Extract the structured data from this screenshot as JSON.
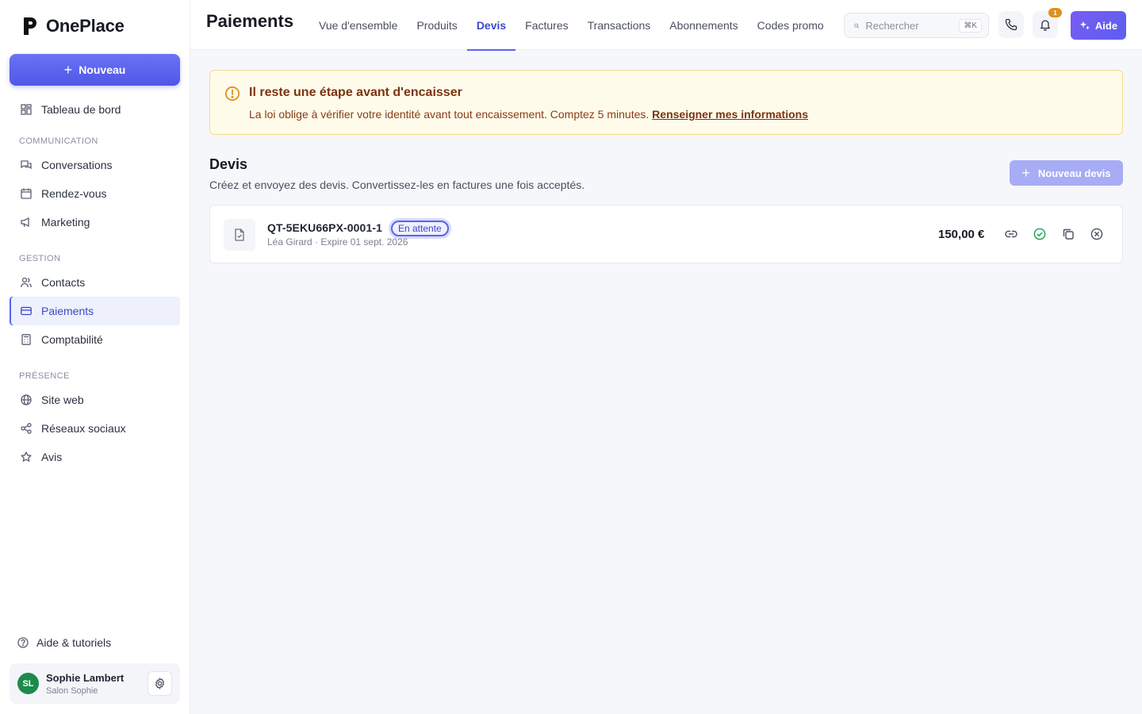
{
  "app": {
    "name": "OnePlace"
  },
  "sidebar": {
    "new_button": "Nouveau",
    "dashboard": "Tableau de bord",
    "sections": [
      {
        "title": "COMMUNICATION",
        "items": [
          "Conversations",
          "Rendez-vous",
          "Marketing"
        ]
      },
      {
        "title": "GESTION",
        "items": [
          "Contacts",
          "Paiements",
          "Comptabilité"
        ]
      },
      {
        "title": "PRÉSENCE",
        "items": [
          "Site web",
          "Réseaux sociaux",
          "Avis"
        ]
      }
    ],
    "active_item": "Paiements",
    "help_link": "Aide & tutoriels",
    "user": {
      "initials": "SL",
      "name": "Sophie Lambert",
      "business": "Salon Sophie"
    }
  },
  "header": {
    "title": "Paiements",
    "tabs": [
      "Vue d'ensemble",
      "Produits",
      "Devis",
      "Factures",
      "Transactions",
      "Abonnements",
      "Codes promo"
    ],
    "active_tab": "Devis",
    "search_placeholder": "Rechercher",
    "search_shortcut": "⌘K",
    "notification_count": "1",
    "help_button": "Aide"
  },
  "alert": {
    "title": "Il reste une étape avant d'encaisser",
    "body": "La loi oblige à vérifier votre identité avant tout encaissement. Comptez 5 minutes.",
    "link": "Renseigner mes informations"
  },
  "quotes": {
    "title": "Devis",
    "description": "Créez et envoyez des devis. Convertissez-les en factures une fois acceptés.",
    "new_button": "Nouveau devis",
    "rows": [
      {
        "id": "QT-5EKU66PX-0001-1",
        "status": "En attente",
        "client": "Léa Girard",
        "expiry": "Expire 01 sept. 2026",
        "amount": "150,00 €"
      }
    ]
  },
  "colors": {
    "accent": "#5b63f0",
    "alert_bg": "#fffbeb",
    "success": "#22a55b",
    "avatar": "#1d8a4b",
    "badge": "#e0901c"
  }
}
